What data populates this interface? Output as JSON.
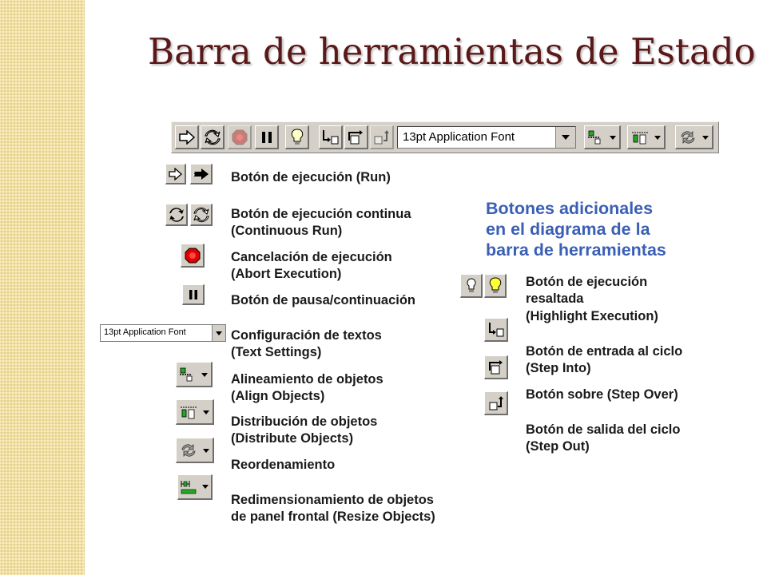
{
  "slide": {
    "title": "Barra de herramientas de Estado",
    "colors": {
      "title": "#5a1818",
      "accent_blue": "#3a5fb5",
      "stripe": "#f3e2a6",
      "toolbar": "#d4d0c8"
    }
  },
  "toolbar": {
    "buttons": [
      "run-icon",
      "continuous-run-icon",
      "abort-icon",
      "pause-icon",
      "highlight-execution-icon",
      "step-into-icon",
      "step-over-icon",
      "step-out-icon",
      "align-objects-icon",
      "distribute-objects-icon",
      "reorder-icon"
    ],
    "font_value": "13pt Application Font"
  },
  "items": {
    "run": "Botón de ejecución (Run)",
    "continuous_line1": "Botón de ejecución continua",
    "continuous_line2": "(Continuous Run)",
    "abort_line1": "Cancelación de ejecución",
    "abort_line2": "(Abort Execution)",
    "pause": "Botón de pausa/continuación",
    "text_line1": "Configuración de textos",
    "text_line2": "(Text Settings)",
    "text_font_value": "13pt Application Font",
    "align_line1": "Alineamiento de objetos",
    "align_line2": "(Align Objects)",
    "distribute_line1": "Distribución de objetos",
    "distribute_line2": "(Distribute Objects)",
    "reorder": "Reordenamiento",
    "resize_line1": "Redimensionamiento de objetos",
    "resize_line2": "de panel frontal (Resize Objects)"
  },
  "additional": {
    "heading": "Botones adicionales en el diagrama de la barra de herramientas",
    "highlight_line1": "Botón de ejecución",
    "highlight_line2": "resaltada",
    "highlight_line3": "(Highlight Execution)",
    "step_into_line1": "Botón de entrada al ciclo",
    "step_into_line2": "(Step Into)",
    "step_over": "Botón sobre (Step Over)",
    "step_out_line1": "Botón de salida del ciclo",
    "step_out_line2": "(Step Out)"
  }
}
